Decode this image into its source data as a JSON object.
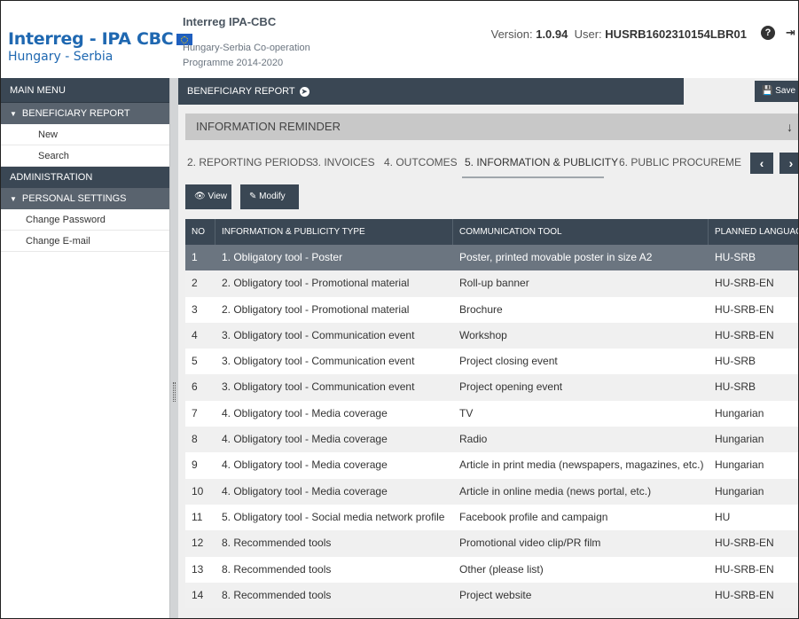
{
  "header": {
    "logo_line1": "Interreg - IPA CBC",
    "logo_line2": "Hungary - Serbia",
    "program_title": "Interreg IPA-CBC",
    "program_sub1": "Hungary-Serbia Co-operation",
    "program_sub2": "Programme 2014-2020",
    "version_label": "Version:",
    "version_value": "1.0.94",
    "user_label": "User:",
    "user_value": "HUSRB1602310154LBR01",
    "help_icon": "question-circle-icon",
    "exit_icon": "sign-out-icon"
  },
  "sidebar": {
    "main_menu": "MAIN MENU",
    "sections": [
      {
        "label": "BENEFICIARY REPORT",
        "items": [
          "New",
          "Search"
        ]
      },
      {
        "label": "ADMINISTRATION",
        "items": []
      },
      {
        "label": "PERSONAL SETTINGS",
        "items": [
          "Change Password",
          "Change E-mail"
        ]
      }
    ]
  },
  "main": {
    "topbar_title": "BENEFICIARY REPORT",
    "save_label": "Save",
    "reminder": "INFORMATION REMINDER",
    "tabs": [
      "2. REPORTING PERIODS",
      "3. INVOICES",
      "4. OUTCOMES",
      "5. INFORMATION & PUBLICITY",
      "6. PUBLIC PROCUREME"
    ],
    "active_tab": "5. INFORMATION & PUBLICITY",
    "view_label": "View",
    "modify_label": "Modify"
  },
  "table": {
    "columns": [
      "NO",
      "INFORMATION & PUBLICITY TYPE",
      "COMMUNICATION TOOL",
      "PLANNED LANGUAG"
    ],
    "rows": [
      [
        "1",
        "1. Obligatory tool - Poster",
        "Poster, printed movable poster in size A2",
        "HU-SRB"
      ],
      [
        "2",
        "2. Obligatory tool - Promotional material",
        "Roll-up banner",
        "HU-SRB-EN"
      ],
      [
        "3",
        "2. Obligatory tool - Promotional material",
        "Brochure",
        "HU-SRB-EN"
      ],
      [
        "4",
        "3. Obligatory tool - Communication event",
        "Workshop",
        "HU-SRB-EN"
      ],
      [
        "5",
        "3. Obligatory tool - Communication event",
        "Project closing event",
        "HU-SRB"
      ],
      [
        "6",
        "3. Obligatory tool - Communication event",
        "Project opening event",
        "HU-SRB"
      ],
      [
        "7",
        "4. Obligatory tool - Media coverage",
        "TV",
        "Hungarian"
      ],
      [
        "8",
        "4. Obligatory tool - Media coverage",
        "Radio",
        "Hungarian"
      ],
      [
        "9",
        "4. Obligatory tool - Media coverage",
        "Article in print media (newspapers, magazines, etc.)",
        "Hungarian"
      ],
      [
        "10",
        "4. Obligatory tool - Media coverage",
        "Article in online media (news portal, etc.)",
        "Hungarian"
      ],
      [
        "11",
        "5. Obligatory tool - Social media network profile",
        "Facebook profile and campaign",
        "HU"
      ],
      [
        "12",
        "8. Recommended tools",
        "Promotional video clip/PR film",
        "HU-SRB-EN"
      ],
      [
        "13",
        "8. Recommended tools",
        "Other (please list)",
        "HU-SRB-EN"
      ],
      [
        "14",
        "8. Recommended tools",
        "Project website",
        "HU-SRB-EN"
      ]
    ],
    "selected_row": 0
  },
  "colors": {
    "dark_bar": "#3a4754",
    "sidebar_section": "#59636e",
    "selected_row": "#6b7580",
    "logo_blue": "#1f68b1"
  }
}
